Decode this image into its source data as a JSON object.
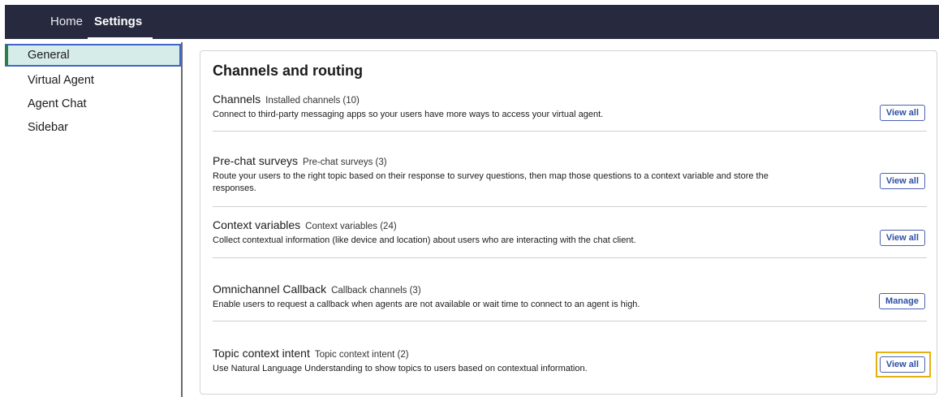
{
  "topnav": {
    "home": "Home",
    "settings": "Settings"
  },
  "sidebar": {
    "items": [
      {
        "label": "General"
      },
      {
        "label": "Virtual Agent"
      },
      {
        "label": "Agent Chat"
      },
      {
        "label": "Sidebar"
      }
    ]
  },
  "main": {
    "title": "Channels and routing",
    "rows": [
      {
        "title": "Channels",
        "subtitle": "Installed channels (10)",
        "description": "Connect to third-party messaging apps so your users have more ways to access your virtual agent.",
        "button": "View all"
      },
      {
        "title": "Pre-chat surveys",
        "subtitle": "Pre-chat surveys (3)",
        "description": "Route your users to the right topic based on their response to survey questions, then map those questions to a context variable and store the responses.",
        "button": "View all"
      },
      {
        "title": "Context variables",
        "subtitle": "Context variables (24)",
        "description": "Collect contextual information (like device and location) about users who are interacting with the chat client.",
        "button": "View all"
      },
      {
        "title": "Omnichannel Callback",
        "subtitle": "Callback channels (3)",
        "description": "Enable users to request a callback when agents are not available or wait time to connect to an agent is high.",
        "button": "Manage"
      },
      {
        "title": "Topic context intent",
        "subtitle": "Topic context intent (2)",
        "description": "Use Natural Language Understanding to show topics to users based on contextual information.",
        "button": "View all"
      }
    ]
  },
  "colors": {
    "topbar": "#272a3f",
    "active_bg": "#d6ece8",
    "accent": "#2f4fa6",
    "highlight": "#e6b10e"
  }
}
